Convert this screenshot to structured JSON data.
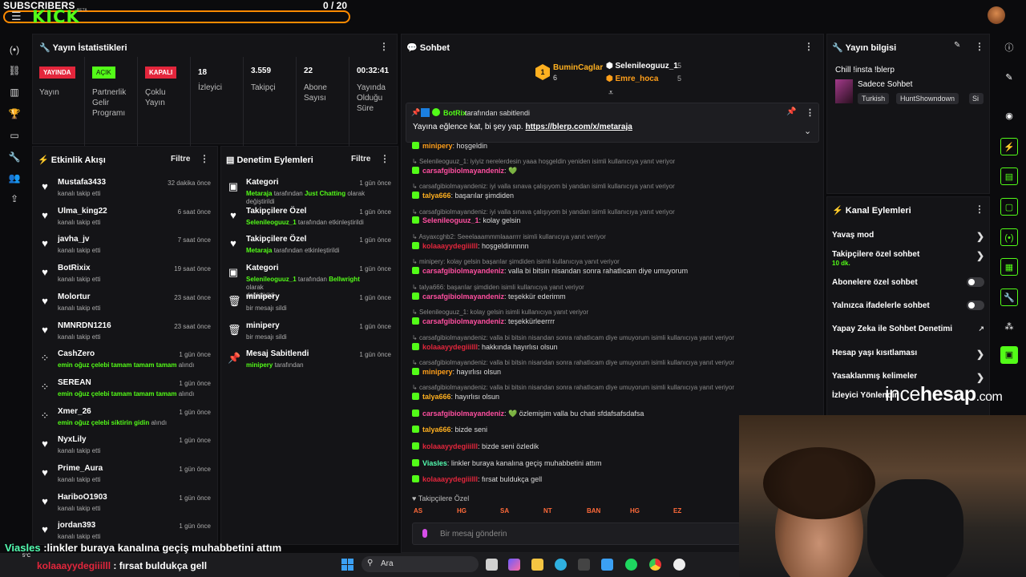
{
  "topbar": {
    "subs_label": "SUBSCRIBERS",
    "subs_count": "0 / 20",
    "logo": "KICK",
    "logo_beta": "BETA"
  },
  "stats": {
    "title": "Yayın İstatistikleri",
    "items": [
      {
        "badge": "YAYINDA",
        "label": "Yayın",
        "badge_color": "#e3263c"
      },
      {
        "badge": "AÇIK",
        "label": "Partnerlik Gelir Programı",
        "badge_color": "#53fc18"
      },
      {
        "badge": "KAPALI",
        "label": "Çoklu Yayın",
        "badge_color": "#e3263c"
      },
      {
        "value": "18",
        "label": "İzleyici"
      },
      {
        "value": "3.559",
        "label": "Takipçi"
      },
      {
        "value": "22",
        "label": "Abone Sayısı"
      },
      {
        "value": "00:32:41",
        "label": "Yayında Olduğu Süre"
      }
    ]
  },
  "activity": {
    "title": "Etkinlik Akışı",
    "filter": "Filtre",
    "items": [
      {
        "name": "Mustafa3433",
        "sub": "kanalı takip etti",
        "time": "32 dakika önce",
        "icon": "heart-icon"
      },
      {
        "name": "Ulma_king22",
        "sub": "kanalı takip etti",
        "time": "6 saat önce",
        "icon": "heart-icon"
      },
      {
        "name": "javha_jv",
        "sub": "kanalı takip etti",
        "time": "7 saat önce",
        "icon": "heart-icon"
      },
      {
        "name": "BotRixix",
        "sub": "kanalı takip etti",
        "time": "19 saat önce",
        "icon": "heart-icon"
      },
      {
        "name": "Molortur",
        "sub": "kanalı takip etti",
        "time": "23 saat önce",
        "icon": "heart-icon"
      },
      {
        "name": "NMNRDN1216",
        "sub": "kanalı takip etti",
        "time": "23 saat önce",
        "icon": "heart-icon"
      },
      {
        "name": "CashZero",
        "sub_user": "emin oğuz çelebi tamam tamam tamam",
        "sub": "alındı",
        "time": "1 gün önce",
        "icon": "reward-icon"
      },
      {
        "name": "SEREAN",
        "sub_user": "emin oğuz çelebi tamam tamam tamam",
        "sub": "alındı",
        "time": "1 gün önce",
        "icon": "reward-icon"
      },
      {
        "name": "Xmer_26",
        "sub_user": "emin oğuz çelebi siktirin gidin",
        "sub": "alındı",
        "time": "1 gün önce",
        "icon": "reward-icon"
      },
      {
        "name": "NyxLily",
        "sub": "kanalı takip etti",
        "time": "1 gün önce",
        "icon": "heart-icon"
      },
      {
        "name": "Prime_Aura",
        "sub": "kanalı takip etti",
        "time": "1 gün önce",
        "icon": "heart-icon"
      },
      {
        "name": "HariboO1903",
        "sub": "kanalı takip etti",
        "time": "1 gün önce",
        "icon": "heart-icon"
      },
      {
        "name": "jordan393",
        "sub": "kanalı takip etti",
        "time": "1 gün önce",
        "icon": "heart-icon"
      }
    ]
  },
  "moderation": {
    "title": "Denetim Eylemleri",
    "filter": "Filtre",
    "items": [
      {
        "name": "Kategori",
        "who": "Metaraja",
        "mid": "tarafından",
        "what": "Just Chatting",
        "tail": "olarak",
        "line2": "değiştirildi",
        "time": "1 gün önce",
        "icon": "category-icon"
      },
      {
        "name": "Takipçilere Özel",
        "who": "Selenileoguuz_1",
        "mid": "tarafından etkinleştirildi",
        "time": "1 gün önce",
        "icon": "heart-icon"
      },
      {
        "name": "Takipçilere Özel",
        "who": "Metaraja",
        "mid": "tarafından etkinleştirildi",
        "time": "1 gün önce",
        "icon": "heart-icon"
      },
      {
        "name": "Kategori",
        "who": "Selenileoguuz_1",
        "mid": "tarafından",
        "what": "Bellwright",
        "tail": "olarak",
        "line2": "değiştirildi",
        "time": "1 gün önce",
        "icon": "category-icon"
      },
      {
        "name": "minipery",
        "plain": "bir mesajı sildi",
        "time": "1 gün önce",
        "icon": "trash-icon"
      },
      {
        "name": "minipery",
        "plain": "bir mesajı sildi",
        "time": "1 gün önce",
        "icon": "trash-icon"
      },
      {
        "name": "Mesaj Sabitlendi",
        "who": "minipery",
        "mid": "tarafından",
        "time": "1 gün önce",
        "icon": "pin-icon"
      }
    ]
  },
  "chat": {
    "title": "Sohbet",
    "leaders": {
      "first": {
        "rank": "1",
        "name": "BuminCaglar",
        "count": "6"
      },
      "second": {
        "name": "Selenileoguuz_1",
        "count": "5"
      },
      "third": {
        "name": "Emre_hoca",
        "count": "5"
      }
    },
    "pinned": {
      "by": "BotRix",
      "by_suffix": "tarafından sabitlendi",
      "text": "Yayına eğlence kat, bi şey yap.",
      "link": "https://blerp.com/x/metaraja"
    },
    "messages": [
      {
        "user": "minipery",
        "cls": "u-orange",
        "text": ": hoşgeldin"
      },
      {
        "reply": "Selenileoguuz_1: iyiyiz nerelerdesin yaaa hoşgeldin yeniden isimli kullanıcıya yanıt veriyor"
      },
      {
        "user": "carsafgibiolmayandeniz",
        "cls": "u-pink",
        "text": ": 💚"
      },
      {
        "reply": "carsafgibiolmayandeniz: iyi valla sınava çalışıyom bi yandan isimli kullanıcıya yanıt veriyor"
      },
      {
        "user": "talya666",
        "cls": "u-gold",
        "text": ": başarılar şimdiden"
      },
      {
        "reply": "carsafgibiolmayandeniz: iyi valla sınava çalışıyom bi yandan isimli kullanıcıya yanıt veriyor"
      },
      {
        "user": "Selenileoguuz_1",
        "cls": "u-pink",
        "text": ": kolay gelsin"
      },
      {
        "reply": "Asyaxcghb2: Seeelaaammmlaaarrrr isimli kullanıcıya yanıt veriyor"
      },
      {
        "user": "kolaaayydegiiilll",
        "cls": "u-red",
        "text": ": hoşgeldinnnnn"
      },
      {
        "reply": "minipery: kolay gelsin başarılar şimdiden isimli kullanıcıya yanıt veriyor"
      },
      {
        "user": "carsafgibiolmayandeniz",
        "cls": "u-pink",
        "text": ": valla bi bitsin nisandan sonra rahatlıcam diye umuyorum"
      },
      {
        "reply": "talya666: başarılar şimdiden isimli kullanıcıya yanıt veriyor"
      },
      {
        "user": "carsafgibiolmayandeniz",
        "cls": "u-pink",
        "text": ": teşekkür ederimm"
      },
      {
        "reply": "Selenileoguuz_1: kolay gelsin isimli kullanıcıya yanıt veriyor"
      },
      {
        "user": "carsafgibiolmayandeniz",
        "cls": "u-pink",
        "text": ": teşekkürleerrrr"
      },
      {
        "reply": "carsafgibiolmayandeniz: valla bi bitsin nisandan sonra rahatlıcam diye umuyorum isimli kullanıcıya yanıt veriyor"
      },
      {
        "user": "kolaaayydegiiilll",
        "cls": "u-red",
        "text": ": hakkında hayırlısı olsun"
      },
      {
        "reply": "carsafgibiolmayandeniz: valla bi bitsin nisandan sonra rahatlıcam diye umuyorum isimli kullanıcıya yanıt veriyor"
      },
      {
        "user": "minipery",
        "cls": "u-orange",
        "text": ": hayırlısı olsun"
      },
      {
        "reply": "carsafgibiolmayandeniz: valla bi bitsin nisandan sonra rahatlıcam diye umuyorum isimli kullanıcıya yanıt veriyor"
      },
      {
        "user": "talya666",
        "cls": "u-gold",
        "text": ": hayırlısı olsun"
      },
      {
        "user": "carsafgibiolmayandeniz",
        "cls": "u-pink",
        "text": ": 💚 özlemişim valla bu chati sfdafsafsdafsa"
      },
      {
        "user": "talya666",
        "cls": "u-gold",
        "text": ": bizde seni"
      },
      {
        "user": "kolaaayydegiiilll",
        "cls": "u-red",
        "text": ": bizde seni özledik"
      },
      {
        "user": "Viasles",
        "cls": "u-teal",
        "text": ": linkler buraya kanalına geçiş muhabbetini attım"
      },
      {
        "user": "kolaaayydegiiilll",
        "cls": "u-red",
        "text": ": fırsat buldukça gell"
      }
    ],
    "followers_only": "Takipçilere Özel",
    "emotes": [
      "AS",
      "HG",
      "SA",
      "NT",
      "BAN",
      "HG",
      "EZ"
    ],
    "input_placeholder": "Bir mesaj gönderin"
  },
  "stream_info": {
    "title": "Yayın bilgisi",
    "stream_title": "Chill !insta !blerp",
    "category": "Sadece Sohbet",
    "tags": [
      "Turkish",
      "HuntShowndown",
      "Si"
    ]
  },
  "channel_actions": {
    "title": "Kanal Eylemleri",
    "items": [
      {
        "label": "Yavaş mod",
        "kind": "chevron"
      },
      {
        "label": "Takipçilere özel sohbet",
        "sub": "10 dk.",
        "kind": "chevron"
      },
      {
        "label": "Abonelere özel sohbet",
        "kind": "toggle"
      },
      {
        "label": "Yalnızca ifadelerle sohbet",
        "kind": "toggle"
      },
      {
        "label": "Yapay Zeka ile Sohbet Denetimi",
        "kind": "external"
      },
      {
        "label": "Hesap yaşı kısıtlaması",
        "kind": "chevron"
      },
      {
        "label": "Yasaklanmış kelimeler",
        "kind": "chevron"
      },
      {
        "label": "İzleyici Yönlendir",
        "kind": "none"
      }
    ]
  },
  "watermark": {
    "a": "ince",
    "b": "hesap",
    "c": ".com"
  },
  "overlay": {
    "line1_user": "Viasles",
    "line1_text": ":linkler buraya kanalına geçiş muhabbetini attım",
    "line2_user": "kolaaayydegiiilll",
    "line2_text": ": fırsat buldukça gell",
    "weather": "5°C"
  },
  "taskbar": {
    "search": "Ara"
  },
  "colors": {
    "brand": "#53fc18",
    "accent_orange": "#ff8a00",
    "live_red": "#e3263c"
  }
}
